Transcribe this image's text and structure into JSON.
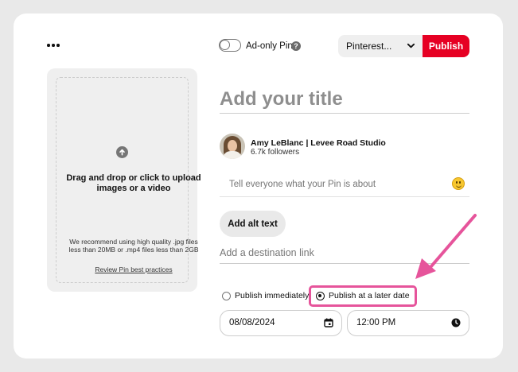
{
  "header": {
    "more_menu_icon": "ellipsis-icon",
    "ad_only_label": "Ad-only Pin",
    "ad_only_enabled": false,
    "help_icon_glyph": "?",
    "board_select_value": "Pinterest...",
    "publish_label": "Publish"
  },
  "upload": {
    "icon": "arrow-up-circle-icon",
    "prompt": "Drag and drop or click to upload images or a video",
    "hint": "We recommend using high quality .jpg files less than 20MB or .mp4 files less than 2GB",
    "link": "Review Pin best practices"
  },
  "form": {
    "title_placeholder": "Add your title",
    "author_name": "Amy LeBlanc | Levee Road Studio",
    "author_followers": "6.7k followers",
    "description_placeholder": "Tell everyone what your Pin is about",
    "alt_text_button": "Add alt text",
    "link_placeholder": "Add a destination link",
    "publish_options": [
      {
        "label": "Publish immediately",
        "selected": false
      },
      {
        "label": "Publish at a later date",
        "selected": true
      }
    ],
    "date_value": "08/08/2024",
    "time_value": "12:00 PM"
  },
  "colors": {
    "publish_red": "#e60023",
    "annotation_pink": "#e6549b"
  }
}
